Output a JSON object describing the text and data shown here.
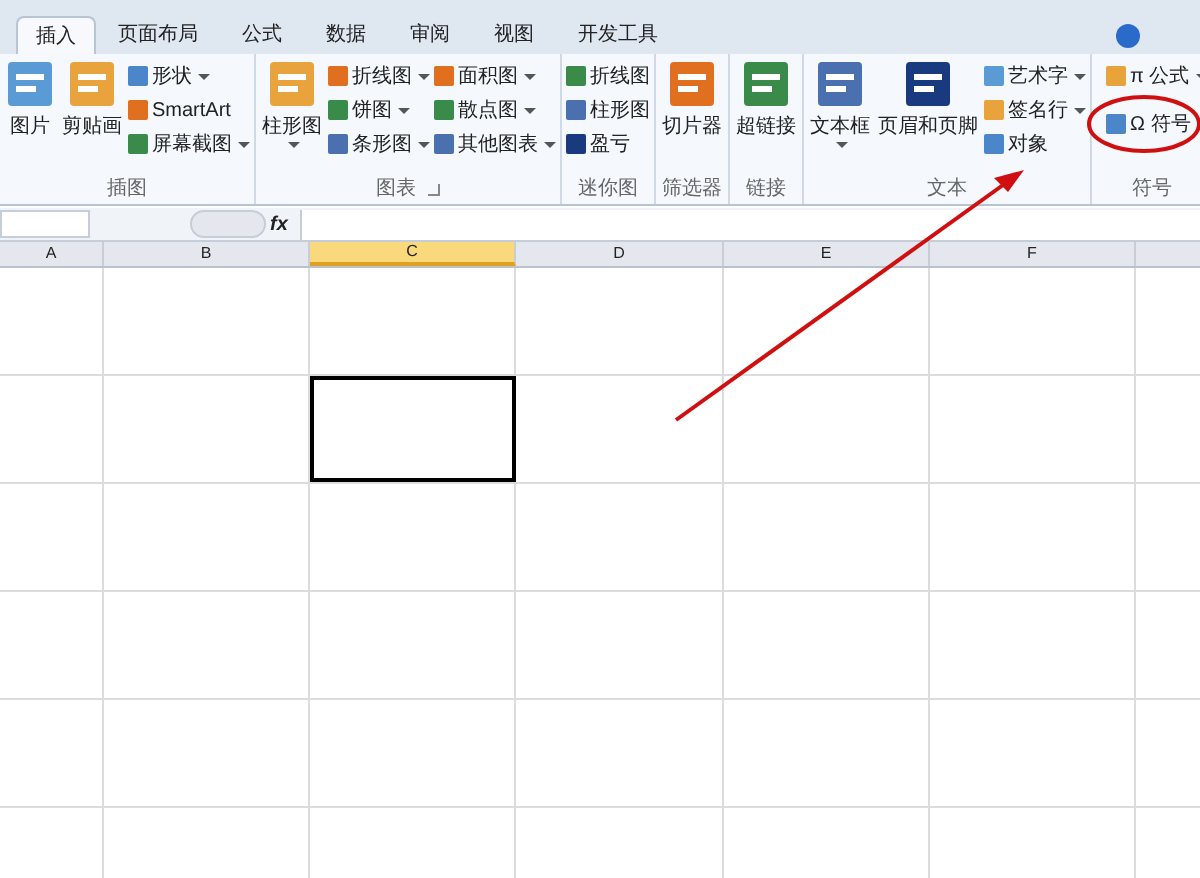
{
  "tabs": [
    {
      "label": "插入",
      "selected": true
    },
    {
      "label": "页面布局",
      "selected": false
    },
    {
      "label": "公式",
      "selected": false
    },
    {
      "label": "数据",
      "selected": false
    },
    {
      "label": "审阅",
      "selected": false
    },
    {
      "label": "视图",
      "selected": false
    },
    {
      "label": "开发工具",
      "selected": false
    }
  ],
  "ribbon_groups": [
    {
      "name": "插图",
      "launcher": false,
      "items": [
        {
          "kind": "large",
          "label": "图片",
          "dropdown": false
        },
        {
          "kind": "large",
          "label": "剪贴画",
          "dropdown": false
        },
        {
          "kind": "column",
          "items": [
            {
              "label": "形状",
              "dropdown": true
            },
            {
              "label": "SmartArt",
              "dropdown": false
            },
            {
              "label": "屏幕截图",
              "dropdown": true
            }
          ]
        }
      ]
    },
    {
      "name": "图表",
      "launcher": true,
      "items": [
        {
          "kind": "large",
          "label": "柱形图",
          "dropdown": true
        },
        {
          "kind": "column",
          "items": [
            {
              "label": "折线图",
              "dropdown": true
            },
            {
              "label": "饼图",
              "dropdown": true
            },
            {
              "label": "条形图",
              "dropdown": true
            }
          ]
        },
        {
          "kind": "column",
          "items": [
            {
              "label": "面积图",
              "dropdown": true
            },
            {
              "label": "散点图",
              "dropdown": true
            },
            {
              "label": "其他图表",
              "dropdown": true
            }
          ]
        }
      ]
    },
    {
      "name": "迷你图",
      "launcher": false,
      "items": [
        {
          "kind": "column",
          "items": [
            {
              "label": "折线图",
              "dropdown": false
            },
            {
              "label": "柱形图",
              "dropdown": false
            },
            {
              "label": "盈亏",
              "dropdown": false
            }
          ]
        }
      ]
    },
    {
      "name": "筛选器",
      "launcher": false,
      "items": [
        {
          "kind": "large",
          "label": "切片器",
          "dropdown": false
        }
      ]
    },
    {
      "name": "链接",
      "launcher": false,
      "items": [
        {
          "kind": "large",
          "label": "超链接",
          "dropdown": false
        }
      ]
    },
    {
      "name": "文本",
      "launcher": false,
      "items": [
        {
          "kind": "large",
          "label": "文本框",
          "dropdown": true
        },
        {
          "kind": "large",
          "label": "页眉和页脚",
          "dropdown": false
        },
        {
          "kind": "column",
          "items": [
            {
              "label": "艺术字",
              "dropdown": true
            },
            {
              "label": "签名行",
              "dropdown": true
            },
            {
              "label": "对象",
              "dropdown": false
            }
          ]
        }
      ]
    },
    {
      "name": "符号",
      "launcher": false,
      "items": [
        {
          "kind": "column",
          "items": [
            {
              "label": "π 公式",
              "dropdown": true
            },
            {
              "label": "Ω 符号",
              "dropdown": false
            }
          ]
        }
      ]
    }
  ],
  "formula_bar": {
    "function_label": "fx"
  },
  "columns": [
    {
      "label": "A",
      "selected": false
    },
    {
      "label": "B",
      "selected": false
    },
    {
      "label": "C",
      "selected": true
    },
    {
      "label": "D",
      "selected": false
    },
    {
      "label": "E",
      "selected": false
    },
    {
      "label": "F",
      "selected": false
    }
  ],
  "rows": [
    {
      "selected_cell": false
    },
    {
      "selected_cell": true
    },
    {
      "selected_cell": false
    },
    {
      "selected_cell": false
    },
    {
      "selected_cell": false
    },
    {
      "selected_cell": false
    }
  ]
}
